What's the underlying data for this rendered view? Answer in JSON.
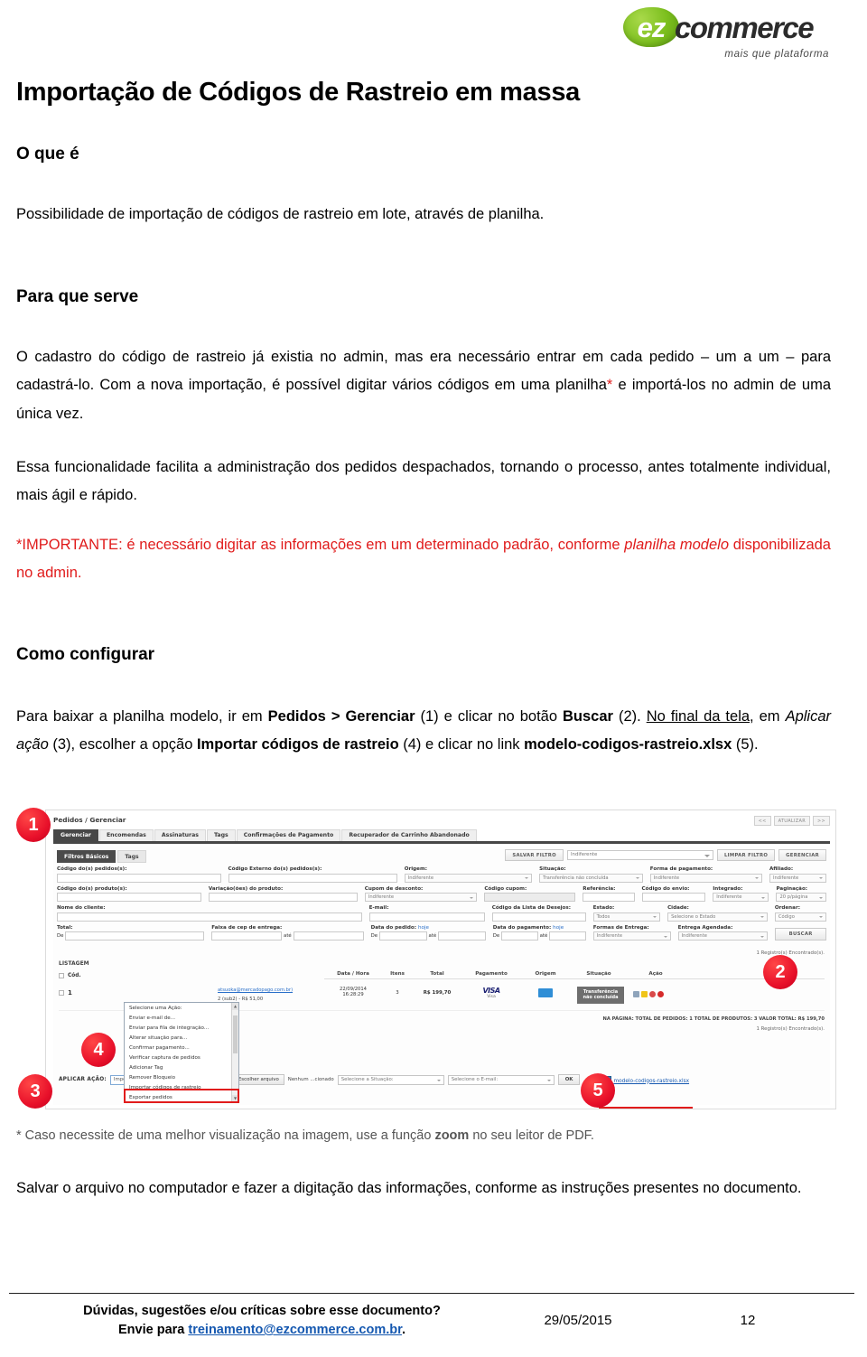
{
  "brand": {
    "logo_mark": "ez",
    "logo_word": "commerce",
    "tagline": "mais que plataforma"
  },
  "document": {
    "title": "Importação de Códigos de Rastreio em massa",
    "sections": {
      "oque_heading": "O que é",
      "oque_text": "Possibilidade de importação de códigos de rastreio em lote, através de planilha.",
      "para_heading": "Para que serve",
      "para_text_1a": "O cadastro do código de rastreio já existia no admin, mas era necessário entrar em cada pedido – um a um – para cadastrá-lo. Com a nova importação, é possível digitar vários códigos em uma planilha",
      "para_text_asterisk": "*",
      "para_text_1b": " e importá-los no admin de uma única vez.",
      "para_text_2": "Essa funcionalidade facilita a administração dos pedidos despachados, tornando o processo, antes totalmente individual, mais ágil e rápido.",
      "important_prefix": "*IMPORTANTE:",
      "important_text_a": " é necessário digitar as informações em um determinado padrão, conforme ",
      "important_italic": "planilha modelo",
      "important_text_b": " disponibilizada no admin.",
      "como_heading": "Como configurar",
      "como_t1": "Para baixar a planilha modelo, ir em ",
      "como_b1": "Pedidos",
      "como_t2": " > ",
      "como_b2": "Gerenciar",
      "como_t3": " (1) e clicar no botão ",
      "como_b3": "Buscar",
      "como_t4": " (2). ",
      "como_u1": "No final da tela",
      "como_t5": ", em ",
      "como_i1": "Aplicar ação",
      "como_t6": " (3), escolher a opção ",
      "como_b4": "Importar códigos de rastreio",
      "como_t7": " (4) e clicar no link ",
      "como_b5": "modelo-codigos-rastreio.xlsx",
      "como_t8": " (5).",
      "image_note_a": "* Caso necessite de uma melhor visualização na imagem, use a função ",
      "image_note_b": "zoom",
      "image_note_c": " no seu leitor de PDF.",
      "final_text": "Salvar o arquivo no computador e fazer a digitação das informações, conforme as instruções presentes no documento."
    }
  },
  "markers": {
    "m1": "1",
    "m2": "2",
    "m3": "3",
    "m4": "4",
    "m5": "5"
  },
  "screenshot": {
    "breadcrumb": "Pedidos / Gerenciar",
    "topright": {
      "prev": "<<",
      "refresh": "ATUALIZAR",
      "next": ">>"
    },
    "tabs": [
      "Gerenciar",
      "Encomendas",
      "Assinaturas",
      "Tags",
      "Confirmações de Pagamento",
      "Recuperador de Carrinho Abandonado"
    ],
    "subtabs": [
      "Filtros Básicos",
      "Tags"
    ],
    "filter_actions": {
      "save": "SALVAR FILTRO",
      "saved_value": "Indiferente",
      "clear": "LIMPAR FILTRO",
      "manage": "GERENCIAR"
    },
    "fields": {
      "codigo_pedidos": "Código do(s) pedidos(s):",
      "codigo_externo": "Código Externo do(s) pedidos(s):",
      "origem": "Origem:",
      "origem_value": "Indiferente",
      "situacao": "Situação:",
      "situacao_value": "Transferência não concluída",
      "forma_pagamento": "Forma de pagamento:",
      "forma_pagamento_value": "Indiferente",
      "afiliado": "Afiliado:",
      "afiliado_value": "Indiferente",
      "codigo_produtos": "Código do(s) produto(s):",
      "variacoes": "Variação(ões) do produto:",
      "cupom_desconto": "Cupom de desconto:",
      "cupom_desconto_value": "Indiferente",
      "codigo_cupom": "Código cupom:",
      "referencia": "Referência:",
      "codigo_envio": "Código do envio:",
      "integrado": "Integrado:",
      "integrado_value": "Indiferente",
      "paginacao": "Paginação:",
      "paginacao_value": "20 p/página",
      "nome_cliente": "Nome do cliente:",
      "email": "E-mail:",
      "codigo_lista": "Código da Lista de Desejos:",
      "estado": "Estado:",
      "estado_value": "Todos",
      "cidade": "Cidade:",
      "cidade_value": "Selecione o Estado",
      "ordenar": "Ordenar:",
      "ordenar_value": "Código",
      "total": "Total:",
      "faixa_cep": "Faixa de cep de entrega:",
      "data_pedido": "Data do pedido:",
      "data_pagamento": "Data do pagamento:",
      "hoje": "hoje",
      "de": "De",
      "ate": "até",
      "formas_entrega": "Formas de Entrega:",
      "formas_entrega_value": "Indiferente",
      "entrega_agendada": "Entrega Agendada:",
      "entrega_agendada_value": "Indiferente",
      "buscar": "BUSCAR"
    },
    "listing": {
      "title": "LISTAGEM",
      "col_cod": "Cód.",
      "records": "1 Registro(s) Encontrado(s).",
      "headers": [
        "Data / Hora",
        "Itens",
        "Total",
        "Pagamento",
        "Origem",
        "Situação",
        "Ação"
      ],
      "row": {
        "cod": "1",
        "email": "atsuoka@mercadopago.com.br)",
        "sub": "2 (sub2) - R$ 51,00",
        "date": "22/09/2014",
        "time": "16:28:29",
        "items": "3",
        "total": "R$ 199,70",
        "payment": "VISA",
        "payment_sub": "Visa",
        "status": "Transferência não concluída"
      },
      "totals": "NA PÁGINA:  TOTAL DE PEDIDOS:  1   TOTAL DE PRODUTOS:  3   VALOR TOTAL:  R$ 199,70"
    },
    "dropdown_options": [
      "Selecione uma Ação:",
      "Enviar e-mail de...",
      "Enviar para fila de integração...",
      "Alterar situação para...",
      "Confirmar pagamento...",
      "Verificar captura de pedidos",
      "Adicionar Tag",
      "Remover Bloqueio",
      "Importar códigos de rastreio",
      "Exportar pedidos"
    ],
    "action_bar": {
      "label": "APLICAR AÇÃO:",
      "selected": "Importar códigos de rastreio",
      "file_button": "Escolher arquivo",
      "file_status": "Nenhum ...cionado",
      "situacao_select": "Selecione a Situação:",
      "email_select": "Selecione o E-mail:",
      "ok": "OK",
      "model_link": "modelo-codigos-rastreio.xlsx"
    }
  },
  "footer": {
    "question": "Dúvidas, sugestões e/ou críticas sobre esse documento?",
    "send_to": "Envie para ",
    "email": "treinamento@ezcommerce.com.br",
    "period": ".",
    "date": "29/05/2015",
    "page": "12"
  },
  "colors": {
    "accent_red": "#e01b1b",
    "brand_green": "#7cbf1e",
    "link_blue": "#1558b0"
  }
}
